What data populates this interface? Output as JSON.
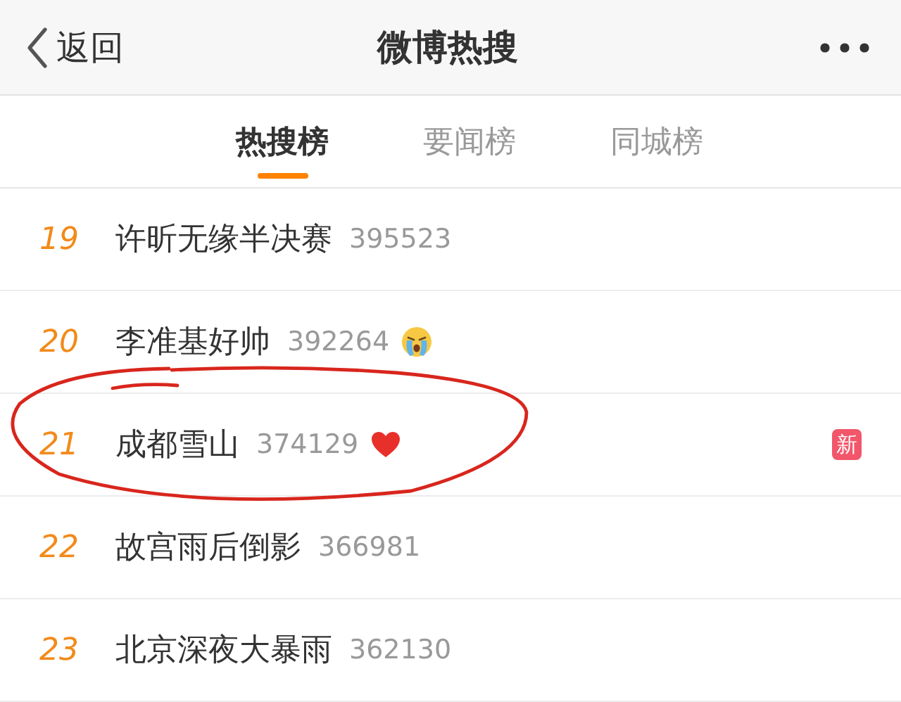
{
  "header": {
    "back_label": "返回",
    "title": "微博热搜"
  },
  "tabs": [
    {
      "label": "热搜榜",
      "selected": true
    },
    {
      "label": "要闻榜",
      "selected": false
    },
    {
      "label": "同城榜",
      "selected": false
    }
  ],
  "rows": [
    {
      "rank": "19",
      "title": "许昕无缘半决赛",
      "count": "395523",
      "kind": "plain"
    },
    {
      "rank": "20",
      "title": "李准基好帅",
      "count": "392264",
      "kind": "crying"
    },
    {
      "rank": "21",
      "title": "成都雪山",
      "count": "374129",
      "kind": "heart",
      "badge": "新"
    },
    {
      "rank": "22",
      "title": "故宫雨后倒影",
      "count": "366981",
      "kind": "plain"
    },
    {
      "rank": "23",
      "title": "北京深夜大暴雨",
      "count": "362130",
      "kind": "plain"
    }
  ]
}
